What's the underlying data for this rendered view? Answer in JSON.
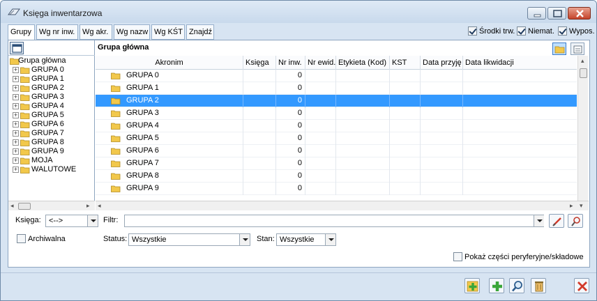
{
  "window": {
    "title": "Księga inwentarzowa"
  },
  "tabs": [
    {
      "label": "Grupy",
      "active": true
    },
    {
      "label": "Wg nr inw.",
      "active": false
    },
    {
      "label": "Wg akr.",
      "active": false
    },
    {
      "label": "Wg nazw",
      "active": false
    },
    {
      "label": "Wg KŚT",
      "active": false
    },
    {
      "label": "Znajdź",
      "active": false
    }
  ],
  "filters_top": [
    {
      "label": "Środki trw.",
      "checked": true
    },
    {
      "label": "Niemat.",
      "checked": true
    },
    {
      "label": "Wypos.",
      "checked": true
    }
  ],
  "tree": {
    "root": "Grupa główna",
    "items": [
      "GRUPA 0",
      "GRUPA 1",
      "GRUPA 2",
      "GRUPA 3",
      "GRUPA 4",
      "GRUPA 5",
      "GRUPA 6",
      "GRUPA 7",
      "GRUPA 8",
      "GRUPA 9",
      "MOJA",
      "WALUTOWE"
    ]
  },
  "grid": {
    "title": "Grupa główna",
    "columns": [
      "Akronim",
      "Księga",
      "Nr inw.",
      "Nr ewid.",
      "Etykieta (Kod)",
      "KST",
      "Data przyję",
      "Data likwidacji"
    ],
    "rows": [
      {
        "akronim": "GRUPA 0",
        "nr_inw": "0"
      },
      {
        "akronim": "GRUPA 1",
        "nr_inw": "0"
      },
      {
        "akronim": "GRUPA 2",
        "nr_inw": "0"
      },
      {
        "akronim": "GRUPA 3",
        "nr_inw": "0"
      },
      {
        "akronim": "GRUPA 4",
        "nr_inw": "0"
      },
      {
        "akronim": "GRUPA 5",
        "nr_inw": "0"
      },
      {
        "akronim": "GRUPA 6",
        "nr_inw": "0"
      },
      {
        "akronim": "GRUPA 7",
        "nr_inw": "0"
      },
      {
        "akronim": "GRUPA 8",
        "nr_inw": "0"
      },
      {
        "akronim": "GRUPA 9",
        "nr_inw": "0"
      }
    ],
    "selected_row": 2
  },
  "bottom": {
    "ksiega_label": "Księga:",
    "ksiega_value": "<-->",
    "filtr_label": "Filtr:",
    "archiwalna_label": "Archiwalna",
    "status_label": "Status:",
    "status_value": "Wszystkie",
    "stan_label": "Stan:",
    "stan_value": "Wszystkie",
    "peryferyjne_label": "Pokaż części peryferyjne/składowe"
  },
  "icons": {
    "folder_color": "#f2c84b",
    "selection_color": "#3399ff",
    "add_color": "#3aa63a",
    "close_color": "#d23a2a"
  }
}
